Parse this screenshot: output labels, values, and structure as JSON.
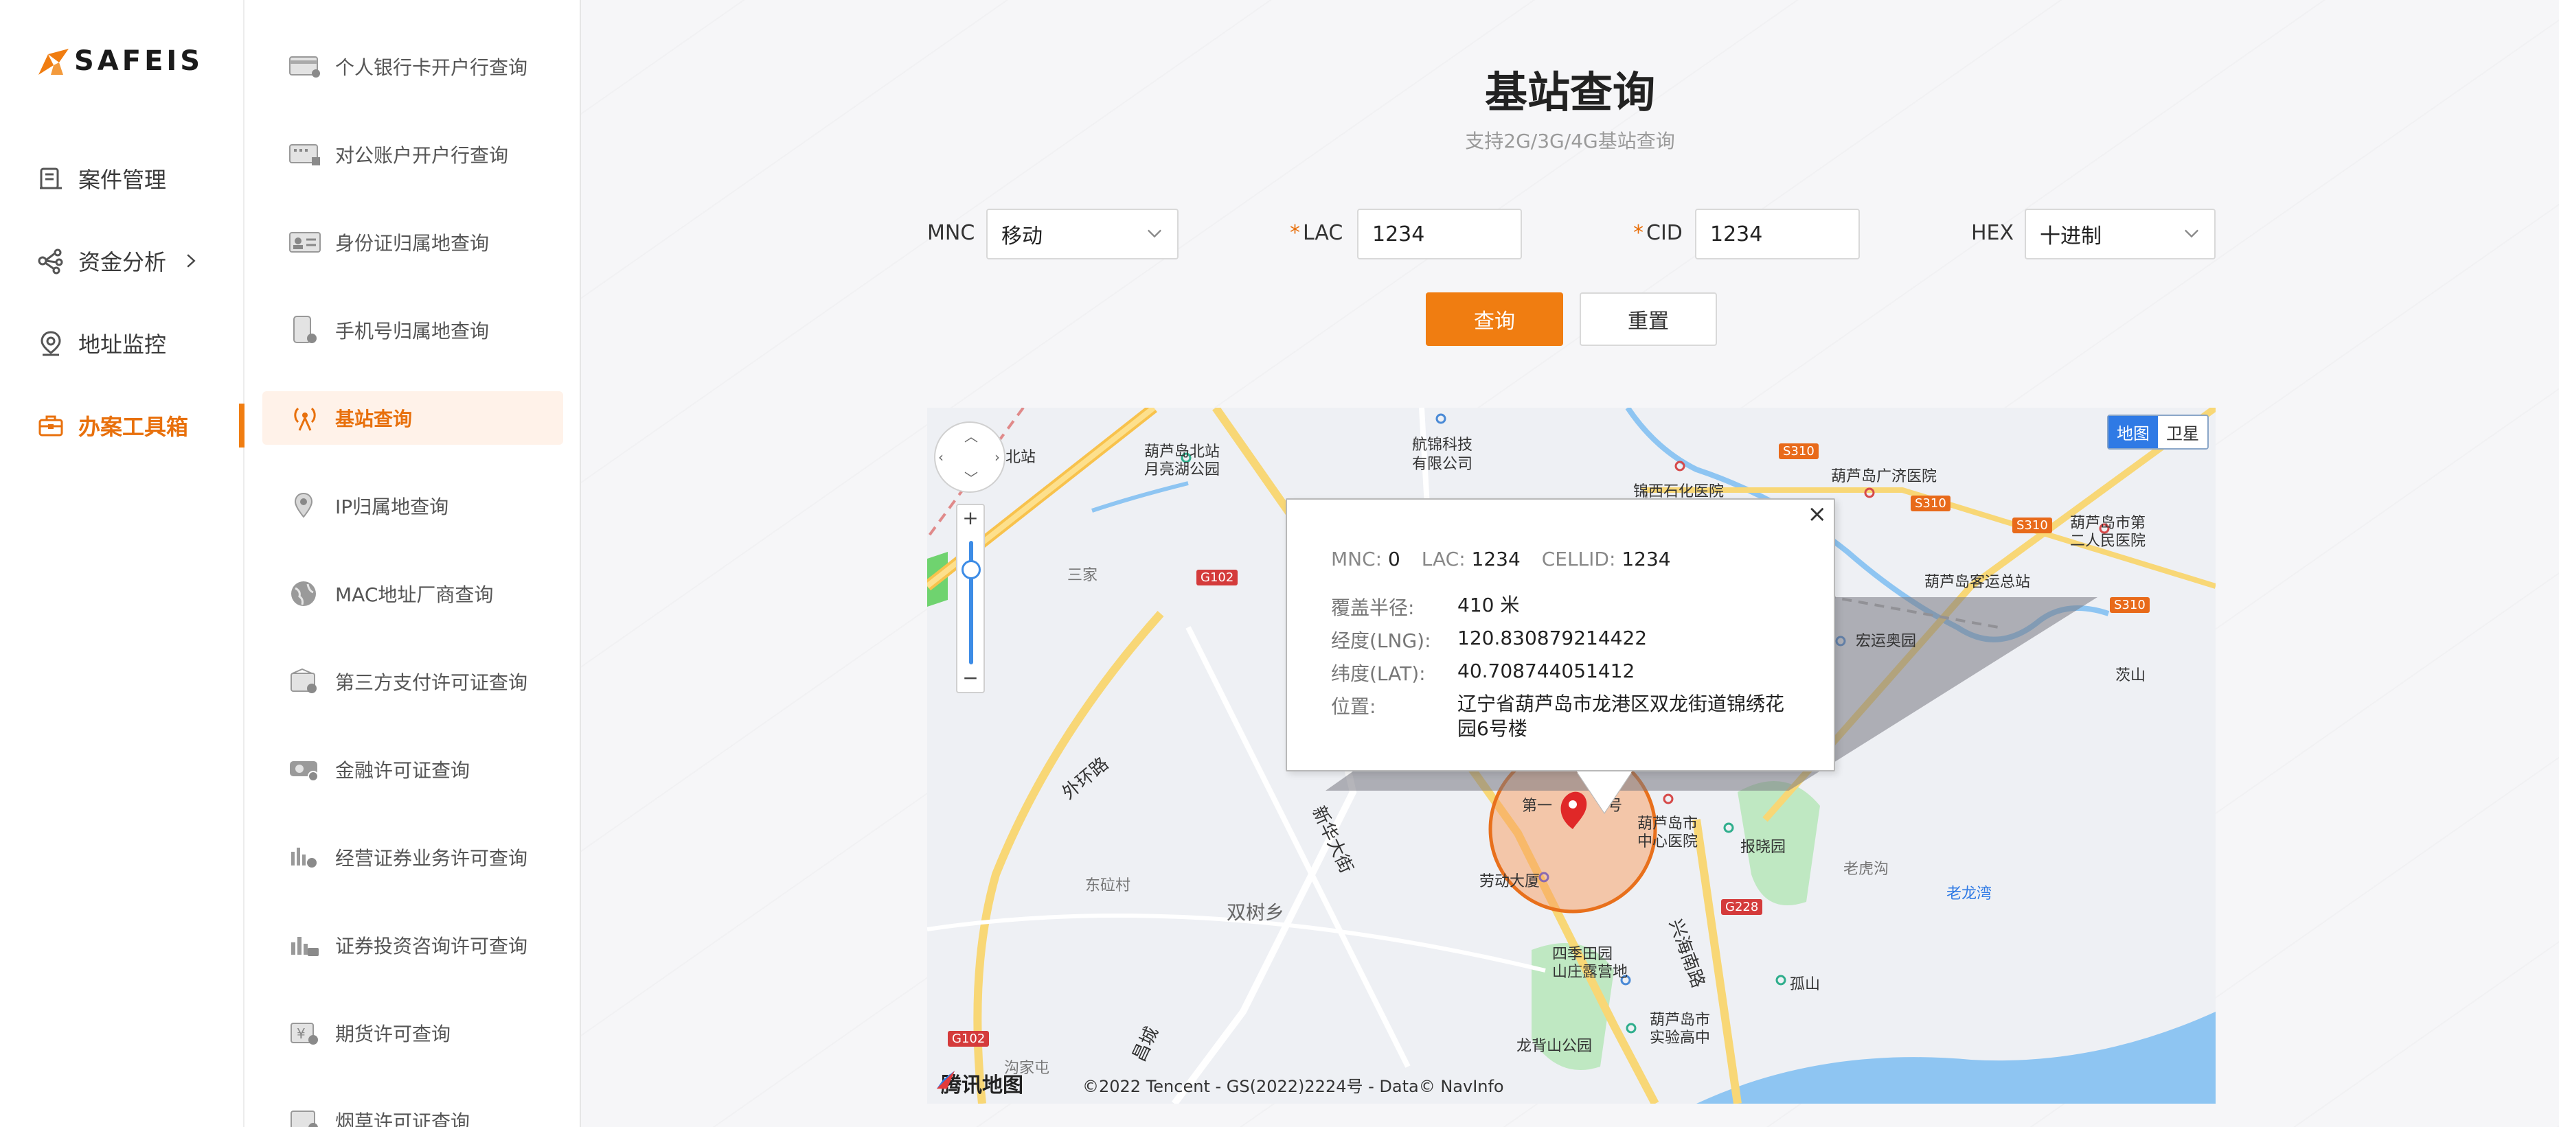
{
  "brand": {
    "name": "SAFEIS",
    "accent": "#f07d11"
  },
  "nav": {
    "items": [
      {
        "label": "案件管理",
        "icon": "case-icon"
      },
      {
        "label": "资金分析",
        "icon": "fund-analysis-icon",
        "has_children": true
      },
      {
        "label": "地址监控",
        "icon": "location-monitor-icon"
      },
      {
        "label": "办案工具箱",
        "icon": "toolbox-icon",
        "active": true
      }
    ]
  },
  "tools": {
    "items": [
      {
        "label": "个人银行卡开户行查询",
        "icon": "bank-card-icon"
      },
      {
        "label": "对公账户开户行查询",
        "icon": "corporate-account-icon"
      },
      {
        "label": "身份证归属地查询",
        "icon": "id-card-icon"
      },
      {
        "label": "手机号归属地查询",
        "icon": "phone-icon"
      },
      {
        "label": "基站查询",
        "icon": "base-station-icon",
        "active": true
      },
      {
        "label": "IP归属地查询",
        "icon": "ip-location-icon"
      },
      {
        "label": "MAC地址厂商查询",
        "icon": "globe-icon"
      },
      {
        "label": "第三方支付许可证查询",
        "icon": "payment-license-icon"
      },
      {
        "label": "金融许可证查询",
        "icon": "finance-license-icon"
      },
      {
        "label": "经营证券业务许可查询",
        "icon": "securities-business-icon"
      },
      {
        "label": "证券投资咨询许可查询",
        "icon": "securities-consult-icon"
      },
      {
        "label": "期货许可查询",
        "icon": "futures-icon"
      },
      {
        "label": "烟草许可证查询",
        "icon": "tobacco-license-icon"
      }
    ]
  },
  "page": {
    "title": "基站查询",
    "subtitle": "支持2G/3G/4G基站查询"
  },
  "form": {
    "mnc_label": "MNC",
    "mnc_value": "移动",
    "lac_label": "LAC",
    "lac_value": "1234",
    "cid_label": "CID",
    "cid_value": "1234",
    "hex_label": "HEX",
    "hex_value": "十进制",
    "required_mark": "*",
    "query_button": "查询",
    "reset_button": "重置"
  },
  "map": {
    "toggle_map": "地图",
    "toggle_satellite": "卫星",
    "provider_logo": "腾讯地图",
    "copyright": "©2022 Tencent - GS(2022)2224号 - Data© NavInfo",
    "labels": [
      "葫芦岛北站",
      "葫芦岛北站",
      "月亮湖公园",
      "航锦科技",
      "有限公司",
      "锦西石化医院",
      "葫芦岛广济医院",
      "葫芦岛市第",
      "二人民医院",
      "葫芦岛客运总站",
      "宏运奥园",
      "茨山",
      "三家",
      "外环路",
      "东砬村",
      "双树乡",
      "新华大街",
      "葫芦岛市",
      "中心医院",
      "报晓园",
      "老虎沟",
      "老龙湾",
      "劳动大厦",
      "四季田园",
      "山庄露营地",
      "孤山",
      "葫芦岛市",
      "实验高中",
      "龙背山公园",
      "兴海南路",
      "沟家屯",
      "昌城",
      "第一",
      "号"
    ],
    "shields": [
      "S310",
      "S310",
      "S310",
      "S310",
      "G102",
      "G102",
      "G228"
    ]
  },
  "popup": {
    "mnc_label": "MNC:",
    "mnc_value": "0",
    "lac_label": "LAC:",
    "lac_value": "1234",
    "cellid_label": "CELLID:",
    "cellid_value": "1234",
    "radius_label": "覆盖半径:",
    "radius_value": "410 米",
    "lng_label": "经度(LNG):",
    "lng_value": "120.830879214422",
    "lat_label": "纬度(LAT):",
    "lat_value": "40.708744051412",
    "address_label": "位置:",
    "address_value": "辽宁省葫芦岛市龙港区双龙街道锦绣花园6号楼",
    "close_glyph": "×"
  }
}
